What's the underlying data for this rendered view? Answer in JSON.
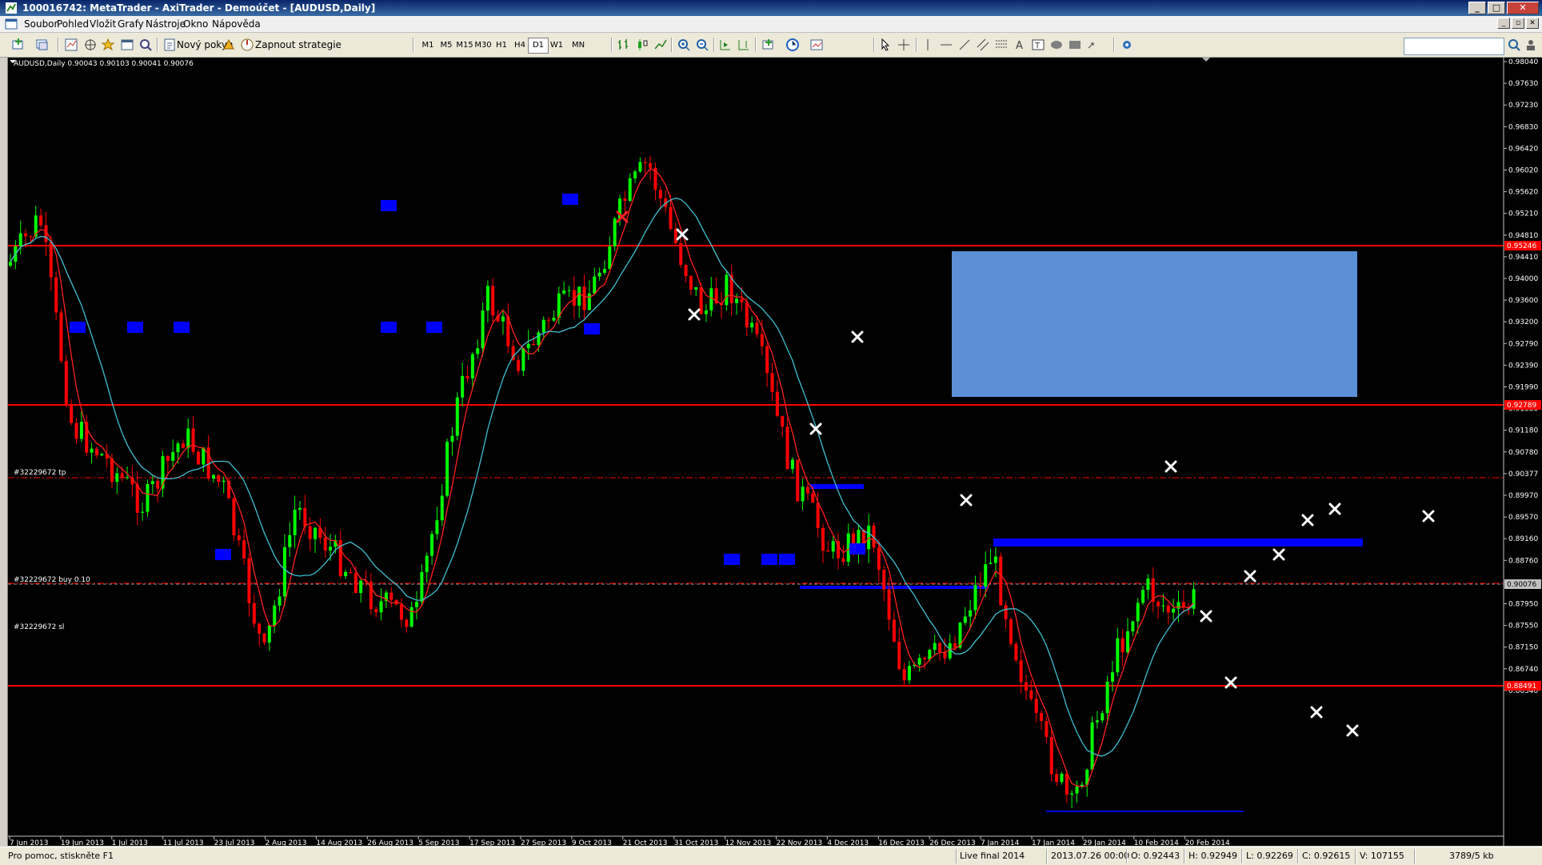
{
  "window": {
    "title": "100016742: MetaTrader - AxiTrader - Demoúčet - [AUDUSD,Daily]"
  },
  "menu": [
    "Soubor",
    "Pohled",
    "Vložit",
    "Grafy",
    "Nástroje",
    "Okno",
    "Nápověda"
  ],
  "toolbar": {
    "new_order": "Nový pokyn",
    "autotrading": "Zapnout strategie",
    "timeframes": [
      "M1",
      "M5",
      "M15",
      "M30",
      "H1",
      "H4",
      "D1",
      "W1",
      "MN"
    ],
    "selected_timeframe": "D1",
    "search_value": ""
  },
  "chart": {
    "symbol_info": "AUDUSD,Daily  0.90043 0.90103 0.90041 0.90076",
    "tp_label": "#32229672 tp",
    "buy_label": "#32229672 buy 0.10",
    "sl_label": "#32229672 sl",
    "price_labels": [
      "0.98040",
      "0.97630",
      "0.97230",
      "0.96830",
      "0.96420",
      "0.96020",
      "0.95620",
      "0.95210",
      "0.94810",
      "0.94410",
      "0.94000",
      "0.93600",
      "0.93200",
      "0.92790",
      "0.92390",
      "0.91990",
      "0.91580",
      "0.91180",
      "0.90780",
      "0.90377",
      "0.89970",
      "0.89570",
      "0.89160",
      "0.88760",
      "0.88360",
      "0.87950",
      "0.87550",
      "0.87150",
      "0.86740",
      "0.86340"
    ],
    "hl_prices": {
      "resistance": "0.95246",
      "mid": "0.92789",
      "support": "0.88491",
      "current": "0.90076"
    },
    "date_labels": [
      "7 Jun 2013",
      "19 Jun 2013",
      "1 Jul 2013",
      "11 Jul 2013",
      "23 Jul 2013",
      "2 Aug 2013",
      "14 Aug 2013",
      "26 Aug 2013",
      "5 Sep 2013",
      "17 Sep 2013",
      "27 Sep 2013",
      "9 Oct 2013",
      "21 Oct 2013",
      "31 Oct 2013",
      "12 Nov 2013",
      "22 Nov 2013",
      "4 Dec 2013",
      "16 Dec 2013",
      "26 Dec 2013",
      "7 Jan 2014",
      "17 Jan 2014",
      "29 Jan 2014",
      "10 Feb 2014",
      "20 Feb 2014"
    ],
    "colors": {
      "bull": "#00ff00",
      "bear": "#ff0000",
      "ma_fast": "#ff2020",
      "ma_slow": "#40c0d0",
      "hline": "#ff0000",
      "zone": "#5b8fd6",
      "marker": "#0000ff"
    }
  },
  "status": {
    "help": "Pro pomoc, stiskněte F1",
    "profile": "Live final 2014",
    "time": "2013.07.26 00:00",
    "open": "O: 0.92443",
    "high": "H: 0.92949",
    "low": "L: 0.92269",
    "close": "C: 0.92615",
    "volume": "V: 107155",
    "traffic": "3789/5 kb"
  }
}
